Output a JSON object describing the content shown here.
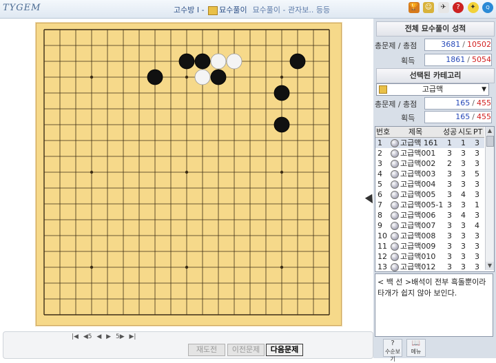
{
  "window": {
    "logo": "TYGEM",
    "title_main": "고수방 I - ",
    "title_mode": "묘수풀이",
    "title_sub": "묘수풀이 - 관자보.. 등등"
  },
  "top_icons": [
    "trophy-icon",
    "person-icon",
    "bird-icon",
    "help-icon",
    "bulb-icon",
    "quiz-icon"
  ],
  "board": {
    "size": 19,
    "stones": [
      {
        "color": "black",
        "col": 7,
        "row": 3
      },
      {
        "color": "black",
        "col": 9,
        "row": 2
      },
      {
        "color": "black",
        "col": 10,
        "row": 2
      },
      {
        "color": "white",
        "col": 11,
        "row": 2
      },
      {
        "color": "white",
        "col": 12,
        "row": 2
      },
      {
        "color": "white",
        "col": 10,
        "row": 3
      },
      {
        "color": "black",
        "col": 11,
        "row": 3
      },
      {
        "color": "black",
        "col": 16,
        "row": 2
      },
      {
        "color": "black",
        "col": 15,
        "row": 4
      },
      {
        "color": "black",
        "col": 15,
        "row": 6
      }
    ],
    "colors": {
      "board": "#f6d98a",
      "line": "#3b2c14"
    }
  },
  "navigation": {
    "first": "|◀",
    "back5": "◀5",
    "prev": "◀",
    "next": "▶",
    "fwd5": "5▶",
    "last": "▶|"
  },
  "buttons": {
    "retry": "재도전",
    "prev_problem": "이전문제",
    "next_problem": "다음문제"
  },
  "overall": {
    "header": "전체 묘수풀이 성적",
    "solved_label": "총문제 / 총점",
    "solved_a": "3681",
    "solved_b": "10502",
    "earned_label": "획득",
    "earned_a": "1861",
    "earned_b": "5054"
  },
  "category": {
    "header": "선택된 카테고리",
    "selected": "고급맥",
    "solved_label": "총문제 / 총점",
    "solved_a": "165",
    "solved_b": "455",
    "earned_label": "획득",
    "earned_a": "165",
    "earned_b": "455"
  },
  "problem_list": {
    "columns": [
      "번호",
      "제목",
      "성공",
      "시도",
      "PT"
    ],
    "rows": [
      {
        "no": "1",
        "title": "고급맥 161",
        "success": "1",
        "tries": "1",
        "pt": "3"
      },
      {
        "no": "2",
        "title": "고급맥001",
        "success": "3",
        "tries": "3",
        "pt": "3"
      },
      {
        "no": "3",
        "title": "고급맥002",
        "success": "2",
        "tries": "3",
        "pt": "3"
      },
      {
        "no": "4",
        "title": "고급맥003",
        "success": "3",
        "tries": "3",
        "pt": "5"
      },
      {
        "no": "5",
        "title": "고급맥004",
        "success": "3",
        "tries": "3",
        "pt": "3"
      },
      {
        "no": "6",
        "title": "고급맥005",
        "success": "3",
        "tries": "4",
        "pt": "3"
      },
      {
        "no": "7",
        "title": "고급맥005-1",
        "success": "3",
        "tries": "3",
        "pt": "1"
      },
      {
        "no": "8",
        "title": "고급맥006",
        "success": "3",
        "tries": "4",
        "pt": "3"
      },
      {
        "no": "9",
        "title": "고급맥007",
        "success": "3",
        "tries": "3",
        "pt": "4"
      },
      {
        "no": "10",
        "title": "고급맥008",
        "success": "3",
        "tries": "3",
        "pt": "3"
      },
      {
        "no": "11",
        "title": "고급맥009",
        "success": "3",
        "tries": "3",
        "pt": "3"
      },
      {
        "no": "12",
        "title": "고급맥010",
        "success": "3",
        "tries": "3",
        "pt": "3"
      },
      {
        "no": "13",
        "title": "고급맥012",
        "success": "3",
        "tries": "3",
        "pt": "3"
      }
    ]
  },
  "comment": "< 백 선 >배석이 전부 흑돌뿐이라 타개가 쉽지 않아 보인다.",
  "footer": {
    "review": "수순보기",
    "menu": "메뉴"
  }
}
